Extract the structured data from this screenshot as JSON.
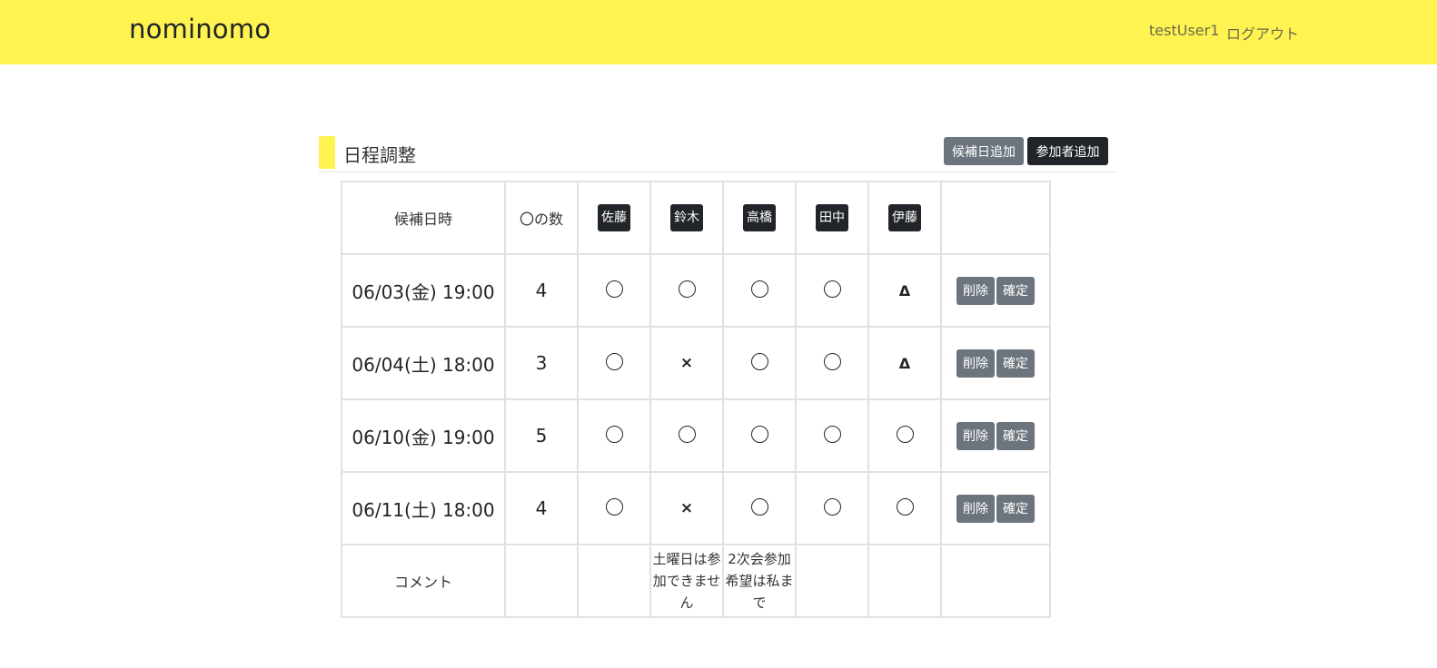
{
  "header": {
    "brand": "nominomo",
    "user": "testUser1",
    "logout": "ログアウト"
  },
  "section": {
    "title": "日程調整",
    "add_date_label": "候補日追加",
    "add_member_label": "参加者追加"
  },
  "table": {
    "col_date": "候補日時",
    "col_count": "〇の数",
    "members": [
      "佐藤",
      "鈴木",
      "高橋",
      "田中",
      "伊藤"
    ],
    "rows": [
      {
        "date": "06/03(金) 19:00",
        "count": "4",
        "marks": [
          "circle",
          "circle",
          "circle",
          "circle",
          "triangle"
        ]
      },
      {
        "date": "06/04(土) 18:00",
        "count": "3",
        "marks": [
          "circle",
          "cross",
          "circle",
          "circle",
          "triangle"
        ]
      },
      {
        "date": "06/10(金) 19:00",
        "count": "5",
        "marks": [
          "circle",
          "circle",
          "circle",
          "circle",
          "circle"
        ]
      },
      {
        "date": "06/11(土) 18:00",
        "count": "4",
        "marks": [
          "circle",
          "cross",
          "circle",
          "circle",
          "circle"
        ]
      }
    ],
    "delete_label": "削除",
    "confirm_label": "確定",
    "comment_label": "コメント",
    "comments": [
      "",
      "土曜日は参加できません",
      "2次会参加希望は私まで",
      "",
      ""
    ]
  },
  "symbols": {
    "triangle": "Δ",
    "cross": "×"
  }
}
